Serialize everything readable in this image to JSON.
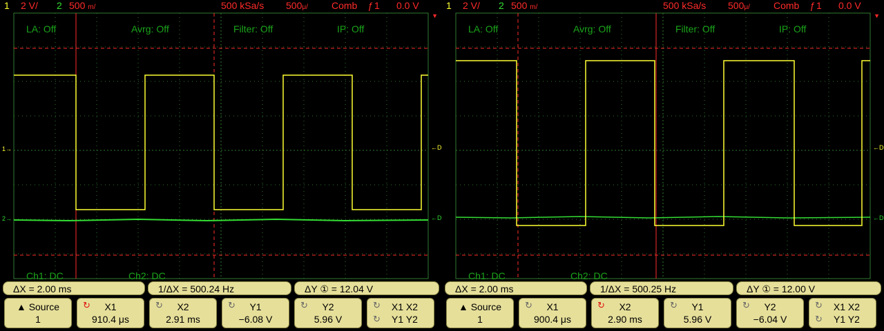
{
  "screens": [
    {
      "header": {
        "ch1_num": "1",
        "ch1_scale": "2 V/",
        "ch2_num": "2",
        "ch2_scale_num": "500",
        "ch2_scale_unit": "m/",
        "sample_rate": "500 kSa/s",
        "timebase_num": "500",
        "timebase_unit": "μ/",
        "mode": "Comb",
        "trigger_icon": "rising-edge-icon",
        "trigger_glyph": "ƒ",
        "trigger_src": "1",
        "trigger_level": "0.0 V"
      },
      "labels": {
        "la": "LA: Off",
        "avrg": "Avrg: Off",
        "filter": "Filter: Off",
        "ip": "IP: Off",
        "ch1": "Ch1: DC",
        "ch2": "Ch2: DC"
      },
      "side": {
        "ch1_marker": "1",
        "ch2_marker": "2",
        "dc1": "DC",
        "dc1_num": "1",
        "dc2": "DC",
        "dc2_num": "2"
      },
      "measure": {
        "dx": "ΔX =  2.00 ms",
        "inv_dx": "1/ΔX = 500.24  Hz",
        "dy": "ΔY ① = 12.04  V"
      },
      "softkeys": {
        "source_label": "Source",
        "source_value": "1",
        "x1_label": "X1",
        "x1_value": "910.4 μs",
        "x2_label": "X2",
        "x2_value": "2.91 ms",
        "y1_label": "Y1",
        "y1_value": "−6.08  V",
        "y2_label": "Y2",
        "y2_value": "5.96  V",
        "xy_top": "X1  X2",
        "xy_bottom": "Y1  Y2",
        "active_cursor": "x1"
      },
      "colors": {
        "ch1": "#ffff33",
        "ch2": "#33dd33",
        "cursor": "#ff2a2a",
        "grid": "#2f7a2f"
      }
    },
    {
      "header": {
        "ch1_num": "1",
        "ch1_scale": "2 V/",
        "ch2_num": "2",
        "ch2_scale_num": "500",
        "ch2_scale_unit": "m/",
        "sample_rate": "500 kSa/s",
        "timebase_num": "500",
        "timebase_unit": "μ/",
        "mode": "Comb",
        "trigger_icon": "rising-edge-icon",
        "trigger_glyph": "ƒ",
        "trigger_src": "1",
        "trigger_level": "0.0 V"
      },
      "labels": {
        "la": "LA: Off",
        "avrg": "Avrg: Off",
        "filter": "Filter: Off",
        "ip": "IP: Off",
        "ch1": "Ch1: DC",
        "ch2": "Ch2: DC"
      },
      "side": {
        "ch1_marker": "1",
        "ch2_marker": "2",
        "dc1": "DC",
        "dc1_num": "1",
        "dc2": "DC",
        "dc2_num": "2"
      },
      "measure": {
        "dx": "ΔX =  2.00 ms",
        "inv_dx": "1/ΔX = 500.25  Hz",
        "dy": "ΔY ① = 12.00  V"
      },
      "softkeys": {
        "source_label": "Source",
        "source_value": "1",
        "x1_label": "X1",
        "x1_value": "900.4 μs",
        "x2_label": "X2",
        "x2_value": "2.90 ms",
        "y1_label": "Y1",
        "y1_value": "5.96  V",
        "y2_label": "Y2",
        "y2_value": "−6.04  V",
        "xy_top": "X1  X2",
        "xy_bottom": "Y1  Y2",
        "active_cursor": "x2"
      },
      "colors": {
        "ch1": "#ffff33",
        "ch2": "#33dd33",
        "cursor": "#ff2a2a",
        "grid": "#2f7a2f"
      }
    }
  ]
}
